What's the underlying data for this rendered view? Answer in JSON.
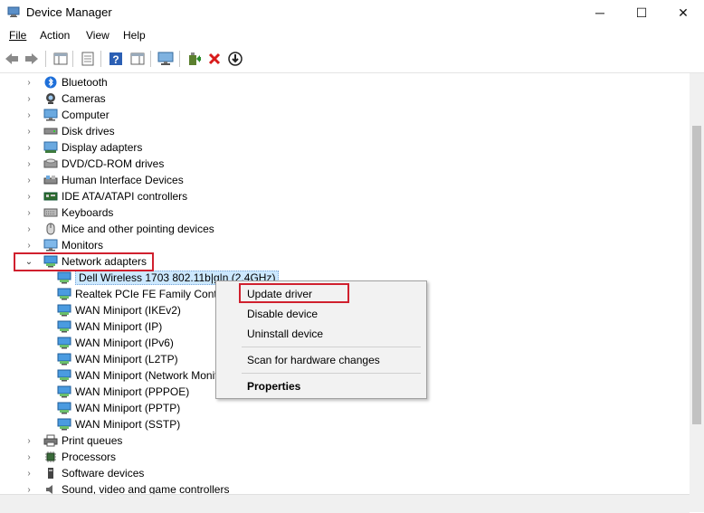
{
  "window": {
    "title": "Device Manager",
    "controls": {
      "minimize": "─",
      "maximize": "☐",
      "close": "✕"
    }
  },
  "menu": [
    {
      "label": "File"
    },
    {
      "label": "Action"
    },
    {
      "label": "View"
    },
    {
      "label": "Help"
    }
  ],
  "toolbar": {
    "icons": [
      "back-icon",
      "forward-icon",
      "show-hide-console-tree-icon",
      "properties-icon",
      "help-icon",
      "action-pane-icon",
      "display-icon",
      "update-driver-icon",
      "uninstall-icon",
      "download-icon"
    ]
  },
  "tree": {
    "categories_top": [
      {
        "label": "Bluetooth",
        "icon": "bluetooth-icon"
      },
      {
        "label": "Cameras",
        "icon": "camera-icon"
      },
      {
        "label": "Computer",
        "icon": "computer-icon"
      },
      {
        "label": "Disk drives",
        "icon": "disk-drive-icon"
      },
      {
        "label": "Display adapters",
        "icon": "display-adapter-icon"
      },
      {
        "label": "DVD/CD-ROM drives",
        "icon": "dvd-drive-icon"
      },
      {
        "label": "Human Interface Devices",
        "icon": "hid-icon"
      },
      {
        "label": "IDE ATA/ATAPI controllers",
        "icon": "ide-controller-icon"
      },
      {
        "label": "Keyboards",
        "icon": "keyboard-icon"
      },
      {
        "label": "Mice and other pointing devices",
        "icon": "mouse-icon"
      },
      {
        "label": "Monitors",
        "icon": "monitor-icon"
      }
    ],
    "expanded_category": {
      "label": "Network adapters",
      "icon": "network-adapter-icon"
    },
    "network_children": [
      {
        "label": "Dell Wireless 1703 802.11b|g|n (2.4GHz)"
      },
      {
        "label": "Realtek PCIe FE Family Controller"
      },
      {
        "label": "WAN Miniport (IKEv2)"
      },
      {
        "label": "WAN Miniport (IP)"
      },
      {
        "label": "WAN Miniport (IPv6)"
      },
      {
        "label": "WAN Miniport (L2TP)"
      },
      {
        "label": "WAN Miniport (Network Monitor)"
      },
      {
        "label": "WAN Miniport (PPPOE)"
      },
      {
        "label": "WAN Miniport (PPTP)"
      },
      {
        "label": "WAN Miniport (SSTP)"
      }
    ],
    "categories_bottom": [
      {
        "label": "Print queues",
        "icon": "printer-icon"
      },
      {
        "label": "Processors",
        "icon": "processor-icon"
      },
      {
        "label": "Software devices",
        "icon": "software-device-icon"
      },
      {
        "label": "Sound, video and game controllers",
        "icon": "sound-icon"
      }
    ]
  },
  "context_menu": {
    "items": [
      {
        "label": "Update driver"
      },
      {
        "label": "Disable device"
      },
      {
        "label": "Uninstall device"
      },
      {
        "label": "Scan for hardware changes"
      },
      {
        "label": "Properties"
      }
    ]
  },
  "highlight_color": "#d0202e",
  "selection_color": "#cce8ff"
}
